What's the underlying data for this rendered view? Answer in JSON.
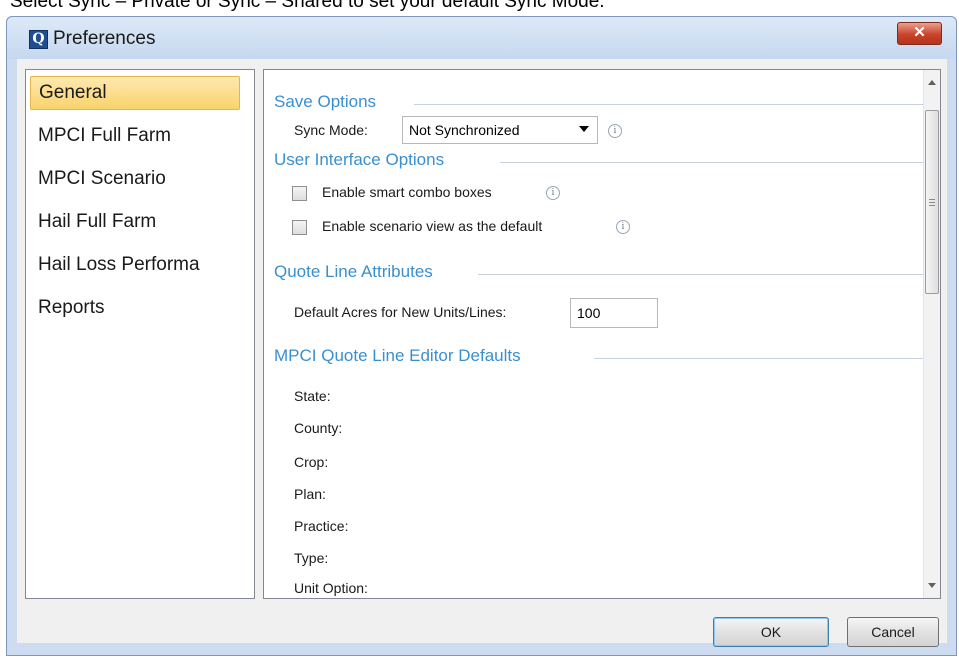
{
  "caption": "Select Sync – Private or Sync – Shared to set your default Sync Mode.",
  "window": {
    "title": "Preferences",
    "app_icon_letter": "Q",
    "close_glyph": "✕"
  },
  "nav": {
    "items": [
      {
        "label": "General",
        "selected": true
      },
      {
        "label": "MPCI Full Farm",
        "selected": false
      },
      {
        "label": "MPCI Scenario",
        "selected": false
      },
      {
        "label": "Hail Full Farm",
        "selected": false
      },
      {
        "label": "Hail Loss Performa",
        "selected": false
      },
      {
        "label": "Reports",
        "selected": false
      }
    ]
  },
  "save_options": {
    "title": "Save Options",
    "sync_label": "Sync Mode:",
    "sync_value": "Not Synchronized"
  },
  "ui_options": {
    "title": "User Interface Options",
    "smart_combo_label": "Enable smart combo boxes",
    "smart_combo_checked": false,
    "scenario_view_label": "Enable scenario view as the default",
    "scenario_view_checked": false
  },
  "quote_line": {
    "title": "Quote Line Attributes",
    "acres_label": "Default Acres for New Units/Lines:",
    "acres_value": "100"
  },
  "mpci_defaults": {
    "title": "MPCI Quote Line Editor Defaults",
    "fields": [
      "State:",
      "County:",
      "Crop:",
      "Plan:",
      "Practice:",
      "Type:",
      "Unit Option:"
    ]
  },
  "info_glyph": "i",
  "buttons": {
    "ok": "OK",
    "cancel": "Cancel"
  }
}
